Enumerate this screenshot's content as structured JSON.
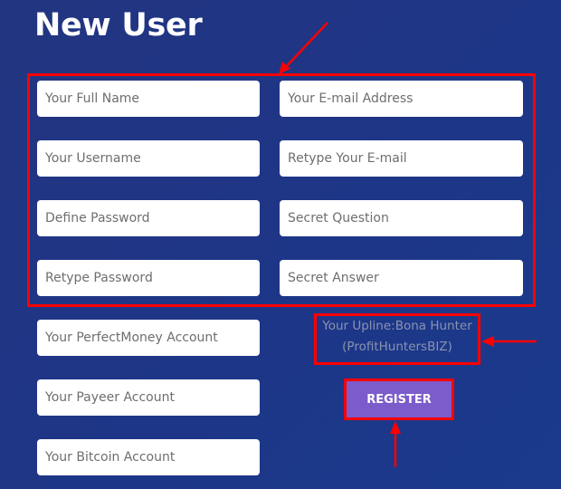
{
  "page": {
    "title": "New User"
  },
  "form": {
    "fields": {
      "full_name": {
        "placeholder": "Your Full Name",
        "value": ""
      },
      "email": {
        "placeholder": "Your E-mail Address",
        "value": ""
      },
      "username": {
        "placeholder": "Your Username",
        "value": ""
      },
      "email_retype": {
        "placeholder": "Retype Your E-mail",
        "value": ""
      },
      "password": {
        "placeholder": "Define Password",
        "value": ""
      },
      "secret_question": {
        "placeholder": "Secret Question",
        "value": ""
      },
      "password_retype": {
        "placeholder": "Retype Password",
        "value": ""
      },
      "secret_answer": {
        "placeholder": "Secret Answer",
        "value": ""
      },
      "perfectmoney": {
        "placeholder": "Your PerfectMoney Account",
        "value": ""
      },
      "payeer": {
        "placeholder": "Your Payeer Account",
        "value": ""
      },
      "bitcoin": {
        "placeholder": "Your Bitcoin Account",
        "value": ""
      }
    },
    "upline": {
      "line1": "Your Upline:Bona Hunter",
      "line2": "(ProfitHuntersBIZ)"
    },
    "register_label": "REGISTER"
  },
  "annotations": {
    "color": "#ff0000"
  },
  "colors": {
    "background": "#20358a",
    "register_button": "#7c5bcb",
    "upline_text": "#8a93b0"
  }
}
